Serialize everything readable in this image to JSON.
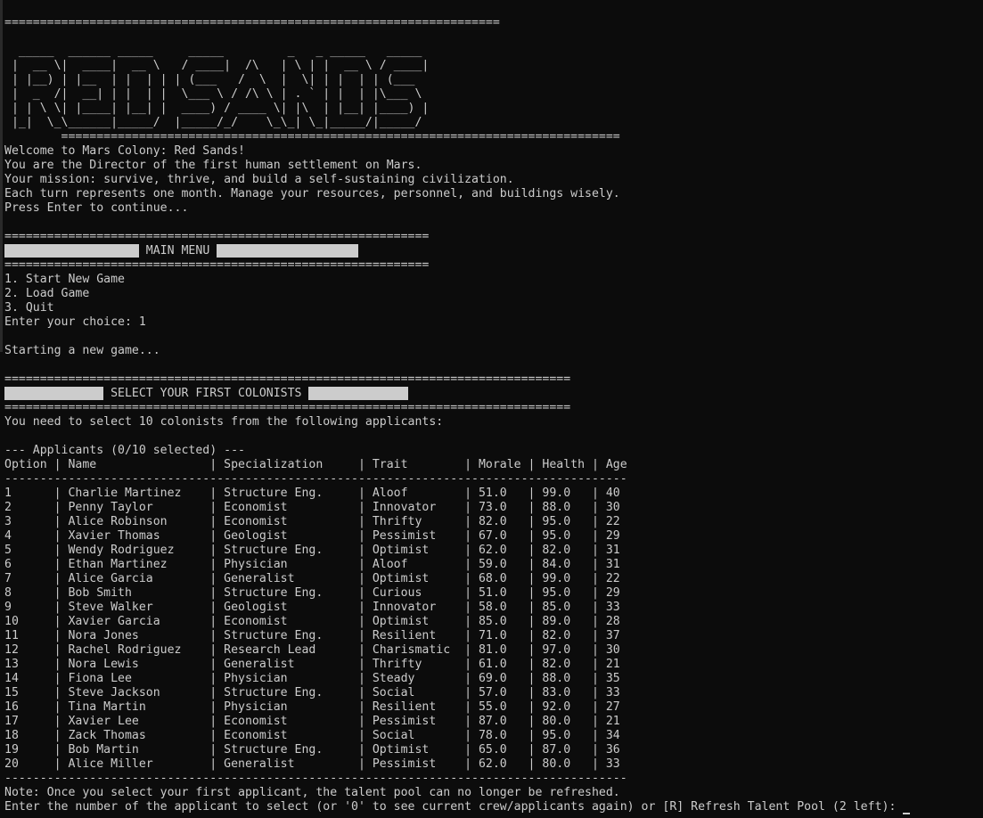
{
  "header": {
    "rule_top": "======================================================================",
    "banner": [
      "  _____  ______ _____     _____         _   _ _____   _____ ",
      " |  __ \\|  ____|  __ \\   / ____|  /\\   | \\ | |  __ \\ / ____|",
      " | |__) | |__  | |  | | | (___   /  \\  |  \\| | |  | | (___  ",
      " |  _  /|  __| | |  | |  \\___ \\ / /\\ \\ | . ` | |  | |\\___ \\ ",
      " | | \\ \\| |____| |__| |  ____) / ____ \\| |\\  | |__| |____) |",
      " |_|  \\_\\______|_____/  |_____/_/    \\_\\_| \\_|_____/|_____/ "
    ],
    "rule_bottom": "        ==============================================================================="
  },
  "intro": {
    "lines": [
      "Welcome to Mars Colony: Red Sands!",
      "You are the Director of the first human settlement on Mars.",
      "Your mission: survive, thrive, and build a self-sustaining civilization.",
      "Each turn represents one month. Manage your resources, personnel, and buildings wisely.",
      "Press Enter to continue..."
    ]
  },
  "main_menu": {
    "rule": "============================================================",
    "bar_left": "                   ",
    "title": " MAIN MENU ",
    "bar_right": "                    ",
    "options": [
      "1. Start New Game",
      "2. Load Game",
      "3. Quit"
    ],
    "prompt": "Enter your choice: 1",
    "status": "Starting a new game..."
  },
  "selection": {
    "rule": "================================================================================",
    "bar_left": "              ",
    "title": " SELECT YOUR FIRST COLONISTS ",
    "bar_right": "              ",
    "instruction": "You need to select 10 colonists from the following applicants:",
    "applicants_header": "--- Applicants (0/10 selected) ---",
    "columns": [
      "Option",
      "Name",
      "Specialization",
      "Trait",
      "Morale",
      "Health",
      "Age"
    ],
    "separator": "----------------------------------------------------------------------------------------",
    "rows": [
      [
        "1",
        "Charlie Martinez",
        "Structure Eng.",
        "Aloof",
        "51.0",
        "99.0",
        "40"
      ],
      [
        "2",
        "Penny Taylor",
        "Economist",
        "Innovator",
        "73.0",
        "88.0",
        "30"
      ],
      [
        "3",
        "Alice Robinson",
        "Economist",
        "Thrifty",
        "82.0",
        "95.0",
        "22"
      ],
      [
        "4",
        "Xavier Thomas",
        "Geologist",
        "Pessimist",
        "67.0",
        "95.0",
        "29"
      ],
      [
        "5",
        "Wendy Rodriguez",
        "Structure Eng.",
        "Optimist",
        "62.0",
        "82.0",
        "31"
      ],
      [
        "6",
        "Ethan Martinez",
        "Physician",
        "Aloof",
        "59.0",
        "84.0",
        "31"
      ],
      [
        "7",
        "Alice Garcia",
        "Generalist",
        "Optimist",
        "68.0",
        "99.0",
        "22"
      ],
      [
        "8",
        "Bob Smith",
        "Structure Eng.",
        "Curious",
        "51.0",
        "95.0",
        "29"
      ],
      [
        "9",
        "Steve Walker",
        "Geologist",
        "Innovator",
        "58.0",
        "85.0",
        "33"
      ],
      [
        "10",
        "Xavier Garcia",
        "Economist",
        "Optimist",
        "85.0",
        "89.0",
        "28"
      ],
      [
        "11",
        "Nora Jones",
        "Structure Eng.",
        "Resilient",
        "71.0",
        "82.0",
        "37"
      ],
      [
        "12",
        "Rachel Rodriguez",
        "Research Lead",
        "Charismatic",
        "81.0",
        "97.0",
        "30"
      ],
      [
        "13",
        "Nora Lewis",
        "Generalist",
        "Thrifty",
        "61.0",
        "82.0",
        "21"
      ],
      [
        "14",
        "Fiona Lee",
        "Physician",
        "Steady",
        "69.0",
        "88.0",
        "35"
      ],
      [
        "15",
        "Steve Jackson",
        "Structure Eng.",
        "Social",
        "57.0",
        "83.0",
        "33"
      ],
      [
        "16",
        "Tina Martin",
        "Physician",
        "Resilient",
        "55.0",
        "92.0",
        "27"
      ],
      [
        "17",
        "Xavier Lee",
        "Economist",
        "Pessimist",
        "87.0",
        "80.0",
        "21"
      ],
      [
        "18",
        "Zack Thomas",
        "Economist",
        "Social",
        "78.0",
        "95.0",
        "34"
      ],
      [
        "19",
        "Bob Martin",
        "Structure Eng.",
        "Optimist",
        "65.0",
        "87.0",
        "36"
      ],
      [
        "20",
        "Alice Miller",
        "Generalist",
        "Pessimist",
        "62.0",
        "80.0",
        "33"
      ]
    ],
    "note": "Note: Once you select your first applicant, the talent pool can no longer be refreshed.",
    "prompt": "Enter the number of the applicant to select (or '0' to see current crew/applicants again) or [R] Refresh Talent Pool (2 left): "
  },
  "colors": {
    "background": "#0c0c0c",
    "text": "#cccccc",
    "highlight_bar": "#cccccc"
  }
}
